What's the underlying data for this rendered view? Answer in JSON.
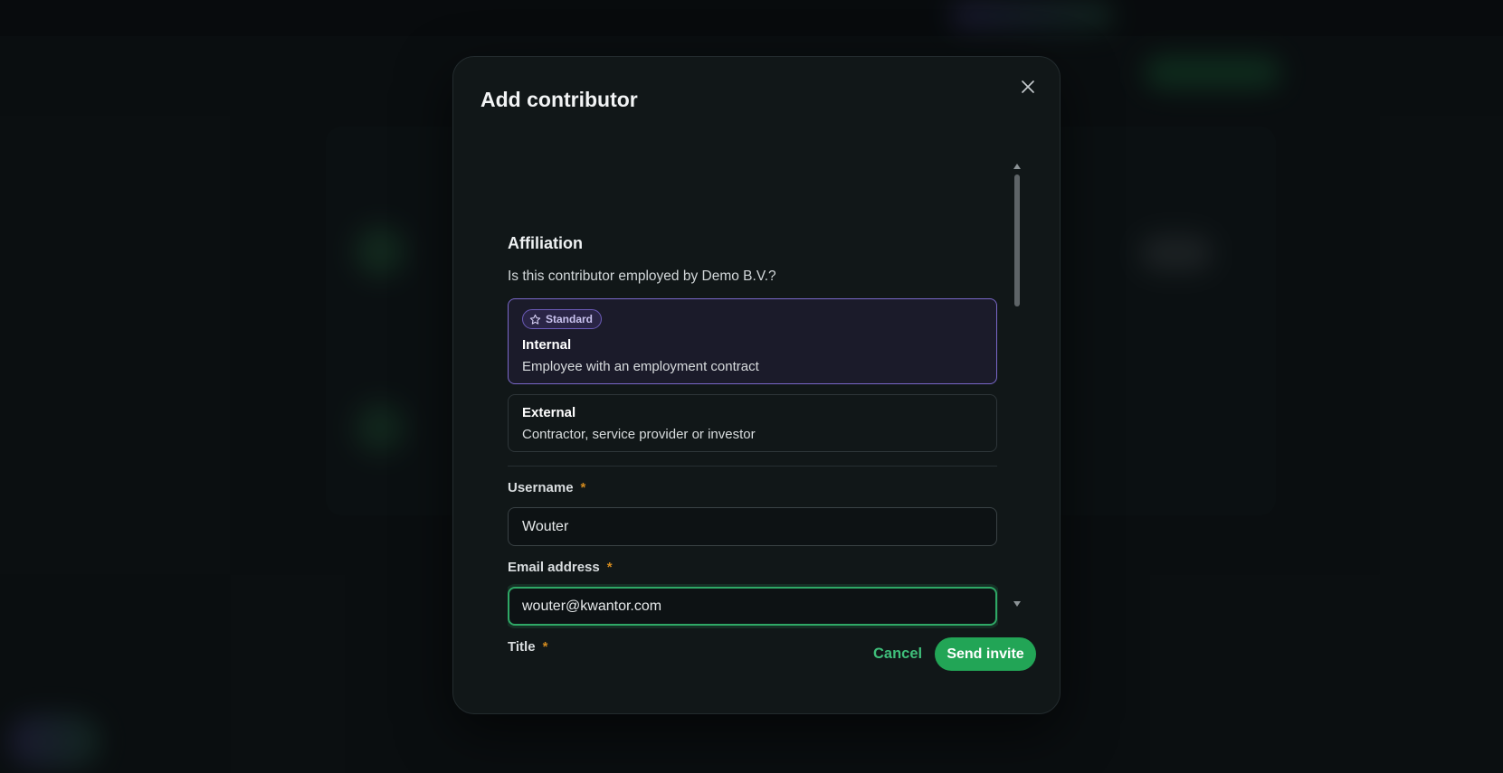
{
  "modal": {
    "title": "Add contributor",
    "close_icon": "close-icon"
  },
  "affiliation": {
    "heading": "Affiliation",
    "question": "Is this contributor employed by Demo B.V.?",
    "options": [
      {
        "badge": "Standard",
        "badge_icon": "star-icon",
        "title": "Internal",
        "description": "Employee with an employment contract",
        "selected": true
      },
      {
        "title": "External",
        "description": "Contractor, service provider or investor",
        "selected": false
      }
    ]
  },
  "form": {
    "username": {
      "label": "Username",
      "required_mark": "*",
      "value": "Wouter"
    },
    "email": {
      "label": "Email address",
      "required_mark": "*",
      "value": "wouter@kwantor.com"
    },
    "title": {
      "label": "Title",
      "required_mark": "*"
    }
  },
  "actions": {
    "cancel_label": "Cancel",
    "send_label": "Send invite"
  },
  "colors": {
    "accent_green": "#22a556",
    "selected_border": "#7a68c9",
    "required": "#d28a1e"
  }
}
